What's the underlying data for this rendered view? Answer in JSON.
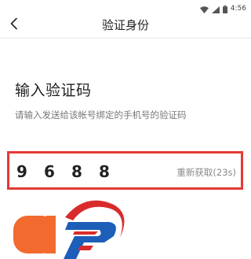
{
  "status_bar": {
    "time": "4:56",
    "icons": [
      "wifi-icon",
      "signal-icon",
      "battery-icon"
    ]
  },
  "nav": {
    "title": "验证身份",
    "back_icon": "chevron-left-icon"
  },
  "main": {
    "heading": "输入验证码",
    "subheading": "请输入发送给该帐号绑定的手机号的验证码",
    "code_digits": [
      "9",
      "6",
      "8",
      "8"
    ],
    "resend_label": "重新获取(23s)"
  },
  "colors": {
    "highlight_border": "#e53935",
    "logo_orange": "#f26a2e",
    "logo_red": "#d92b2b",
    "logo_blue": "#1d5fb8"
  }
}
